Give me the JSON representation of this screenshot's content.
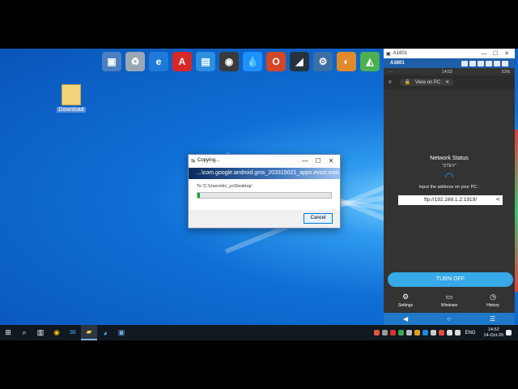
{
  "desktop": {
    "file_label": "Download",
    "dock": [
      {
        "icon": "network-computer-icon",
        "color": "#4b7fc0",
        "glyph": "▣"
      },
      {
        "icon": "recycle-bin-icon",
        "color": "#9aa7b4",
        "glyph": "♻"
      },
      {
        "icon": "ie-browser-icon",
        "color": "#1e7ad9",
        "glyph": "e"
      },
      {
        "icon": "autocad-icon",
        "color": "#d72828",
        "glyph": "A"
      },
      {
        "icon": "utility-app-icon",
        "color": "#2d8fe0",
        "glyph": "▤"
      },
      {
        "icon": "disk-tool-icon",
        "color": "#3a3a3a",
        "glyph": "◉"
      },
      {
        "icon": "water-drop-icon",
        "color": "#1e90ff",
        "glyph": "💧"
      },
      {
        "icon": "office-icon",
        "color": "#d24726",
        "glyph": "O"
      },
      {
        "icon": "monitor-app-icon",
        "color": "#26323e",
        "glyph": "◢"
      },
      {
        "icon": "settings-gear-icon",
        "color": "#3a6ea5",
        "glyph": "⚙"
      },
      {
        "icon": "color-wheel-icon",
        "color": "#e08a2b",
        "glyph": "◐"
      },
      {
        "icon": "chart-app-icon",
        "color": "#4caf50",
        "glyph": "◭"
      }
    ]
  },
  "dialog": {
    "title": "Copying...",
    "filename": "...\\com.google.android.gms_203315021_apps.evozi.com",
    "destination": "To 'C:\\Users\\dz_yo\\Desktop'",
    "progress": 0.02,
    "cancel_label": "Cancel"
  },
  "phone": {
    "window_title": "A1601",
    "header_title": "A1601",
    "status_time": "14:53",
    "status_battery": "51%",
    "view_on_pc": "View on PC",
    "network_status": "Network Status",
    "ssid": "\"ZTEY\"",
    "input_hint": "Input the address on your PC :",
    "ftp_address": "ftp://192.168.1.2:1919/",
    "turn_off": "TURN OFF",
    "tabs": [
      "Settings",
      "Windows",
      "History"
    ]
  },
  "taskbar": {
    "language": "ENG",
    "time": "14:52",
    "date": "14-Oct-20"
  }
}
